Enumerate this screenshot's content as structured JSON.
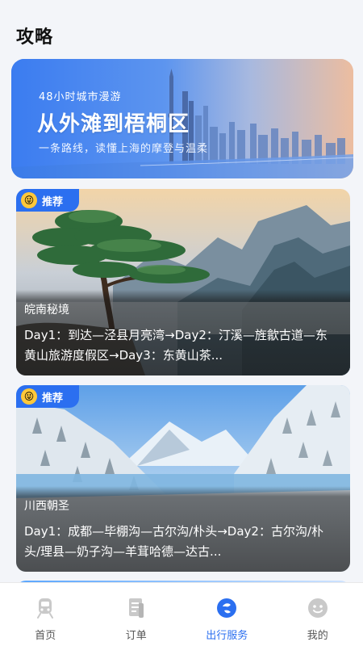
{
  "header": {
    "title": "攻略"
  },
  "banner": {
    "subtitle": "48小时城市漫游",
    "title": "从外滩到梧桐区",
    "description": "一条路线，读懂上海的摩登与温柔"
  },
  "cards": [
    {
      "badge": "推荐",
      "badge_emoji": "😜",
      "region": "皖南秘境",
      "route": "Day1：到达—泾县月亮湾→Day2：汀溪—旌歙古道—东黄山旅游度假区→Day3：东黄山茶..."
    },
    {
      "badge": "推荐",
      "badge_emoji": "😜",
      "region": "川西朝圣",
      "route": "Day1：成都—毕棚沟—古尔沟/朴头→Day2：古尔沟/朴头/理县—奶子沟—羊茸哈德—达古..."
    }
  ],
  "tabbar": {
    "items": [
      {
        "label": "首页",
        "icon": "train-icon",
        "active": false
      },
      {
        "label": "订单",
        "icon": "order-icon",
        "active": false
      },
      {
        "label": "出行服务",
        "icon": "travel-service-icon",
        "active": true
      },
      {
        "label": "我的",
        "icon": "profile-icon",
        "active": false
      }
    ]
  },
  "colors": {
    "accent": "#2b6ff0",
    "badge": "#2b6ff0",
    "background": "#f3f5f9"
  }
}
